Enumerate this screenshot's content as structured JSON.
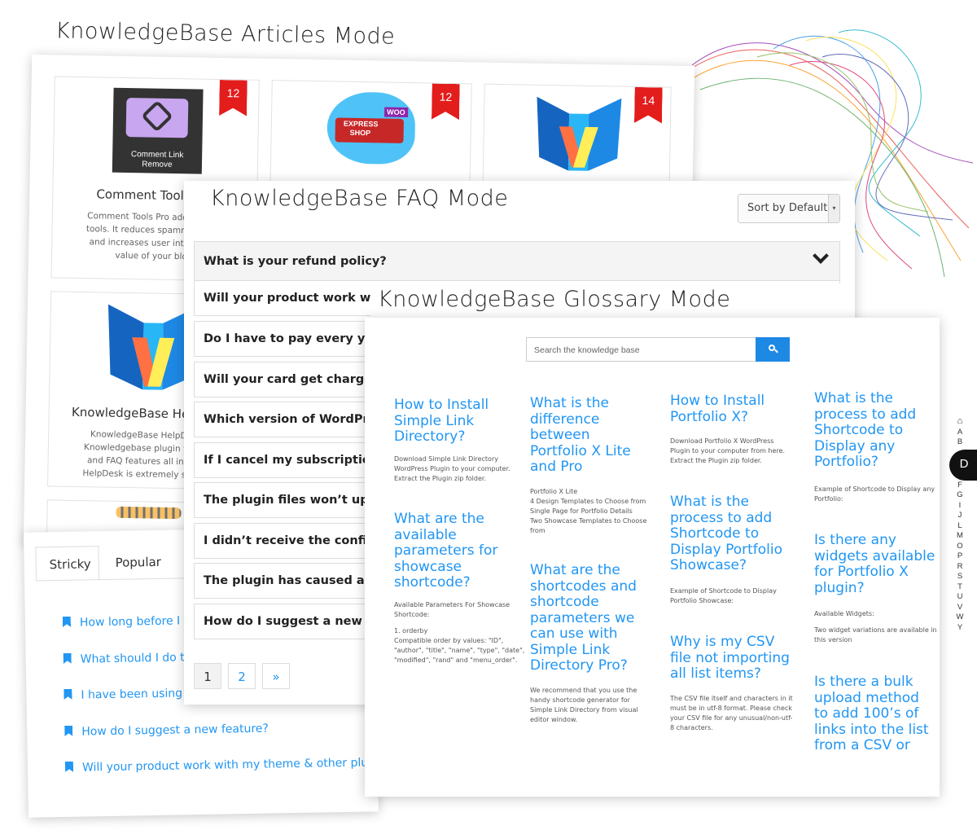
{
  "headings": {
    "articles": "KnowledgeBase Articles Mode",
    "faq": "KnowledgeBase FAQ Mode",
    "glossary": "KnowledgeBase Glossary Mode"
  },
  "articles": {
    "cards": [
      {
        "badge": "12",
        "title": "Comment Tools Pro",
        "logo_text": [
          "Comment Link",
          "Remove"
        ],
        "description": [
          "Comment Tools Pro adds an ars",
          "tools. It reduces spammy, low q",
          "and increases user interactivit",
          "value of your blog"
        ]
      },
      {
        "badge": "12",
        "title": "",
        "logo_text": [
          "EXPRESS",
          "SHOP",
          "WOO"
        ]
      },
      {
        "badge": "14",
        "title": ""
      },
      {
        "title": "KnowledgeBase HelpDesk",
        "description": [
          "KnowledgeBase HelpDesk is",
          "Knowledgebase plugin with hel",
          "and FAQ features all in one. K",
          "HelpDesk is extremely simple a"
        ]
      }
    ]
  },
  "tabs": {
    "items": [
      "Stricky",
      "Popular"
    ],
    "entries": [
      "How long before I g",
      "What should I do to",
      "I have been using th",
      "How do I suggest a new feature?",
      "Will your product work with my theme & other plugins?"
    ]
  },
  "faq": {
    "sort_label": "Sort by Default",
    "questions": [
      "What is your refund policy?",
      "Will your product work with",
      "Do I have to pay every year",
      "Will your card get charged a",
      "Which version of WordPress",
      "If I cancel my subscription,",
      "The plugin files won’t uploa",
      "I didn’t receive the confirm",
      "The plugin has caused a fat",
      "How do I suggest a new fea"
    ],
    "pages": [
      "1",
      "2",
      "»"
    ]
  },
  "glossary": {
    "search_placeholder": "Search the knowledge base",
    "columns": [
      [
        {
          "q": [
            "How to Install",
            "Simple Link",
            "Directory?"
          ],
          "a": [
            "Download Simple Link Directory",
            "WordPress Plugin to your computer.",
            "Extract the Plugin zip folder."
          ]
        },
        {
          "q": [
            "What are the",
            "available",
            "parameters for",
            "showcase",
            "shortcode?"
          ],
          "a": [
            "Available Parameters For Showcase",
            "Shortcode:",
            "",
            "1. orderby",
            "Compatible order by values: \"ID\",",
            "\"author\", \"title\", \"name\", \"type\", \"date\",",
            "\"modified\", \"rand\" and \"menu_order\"."
          ]
        }
      ],
      [
        {
          "q": [
            "What is the",
            "difference",
            "between",
            "Portfolio X Lite",
            "and Pro"
          ],
          "a": [
            "Portfolio X Lite",
            "4 Design Templates to Choose from",
            "Single Page for Portfolio Details",
            "Two Showcase Templates to Choose",
            "from"
          ]
        },
        {
          "q": [
            "What are the",
            "shortcodes and",
            "shortcode",
            "parameters we",
            "can use with",
            "Simple Link",
            "Directory Pro?"
          ],
          "a": [
            "We recommend that you use the",
            "handy shortcode generator for",
            "Simple Link Directory from visual",
            "editor window."
          ]
        }
      ],
      [
        {
          "q": [
            "How to Install",
            "Portfolio X?"
          ],
          "a": [
            "Download Portfolio X WordPress",
            "Plugin to your computer from here.",
            "Extract the Plugin zip folder."
          ]
        },
        {
          "q": [
            "What is the",
            "process to add",
            "Shortcode to",
            "Display Portfolio",
            "Showcase?"
          ],
          "a": [
            "Example of Shortcode to Display",
            "Portfolio Showcase:"
          ]
        },
        {
          "q": [
            "Why is my CSV",
            "file not importing",
            "all list items?"
          ],
          "a": [
            "The CSV file itself and characters in it",
            "must be in utf-8 format. Please check",
            "your CSV file for any unusual/non-utf-",
            "8 characters."
          ]
        }
      ],
      [
        {
          "q": [
            "What is the",
            "process to add",
            "Shortcode to",
            "Display any",
            "Portfolio?"
          ],
          "a": [
            "Example of Shortcode to Display any",
            "Portfolio:"
          ]
        },
        {
          "q": [
            "Is there any",
            "widgets available",
            "for Portfolio X",
            "plugin?"
          ],
          "a": [
            "Available Widgets:",
            "",
            "Two widget variations are available in",
            "this version"
          ]
        },
        {
          "q": [
            "Is there a bulk",
            "upload method",
            "to add 100’s of",
            "links into the list",
            "from a CSV or"
          ],
          "a": []
        }
      ]
    ]
  },
  "az_nav": {
    "home_icon": "home-icon",
    "letters_before": [
      "A",
      "B"
    ],
    "active": "D",
    "letters_after": [
      "F",
      "G",
      "I",
      "J",
      "L",
      "M",
      "O",
      "P",
      "R",
      "S",
      "T",
      "U",
      "V",
      "W",
      "Y"
    ]
  },
  "colors": {
    "accent": "#2196f3",
    "badge": "#e31c1c",
    "search_button": "#1e88e5"
  }
}
